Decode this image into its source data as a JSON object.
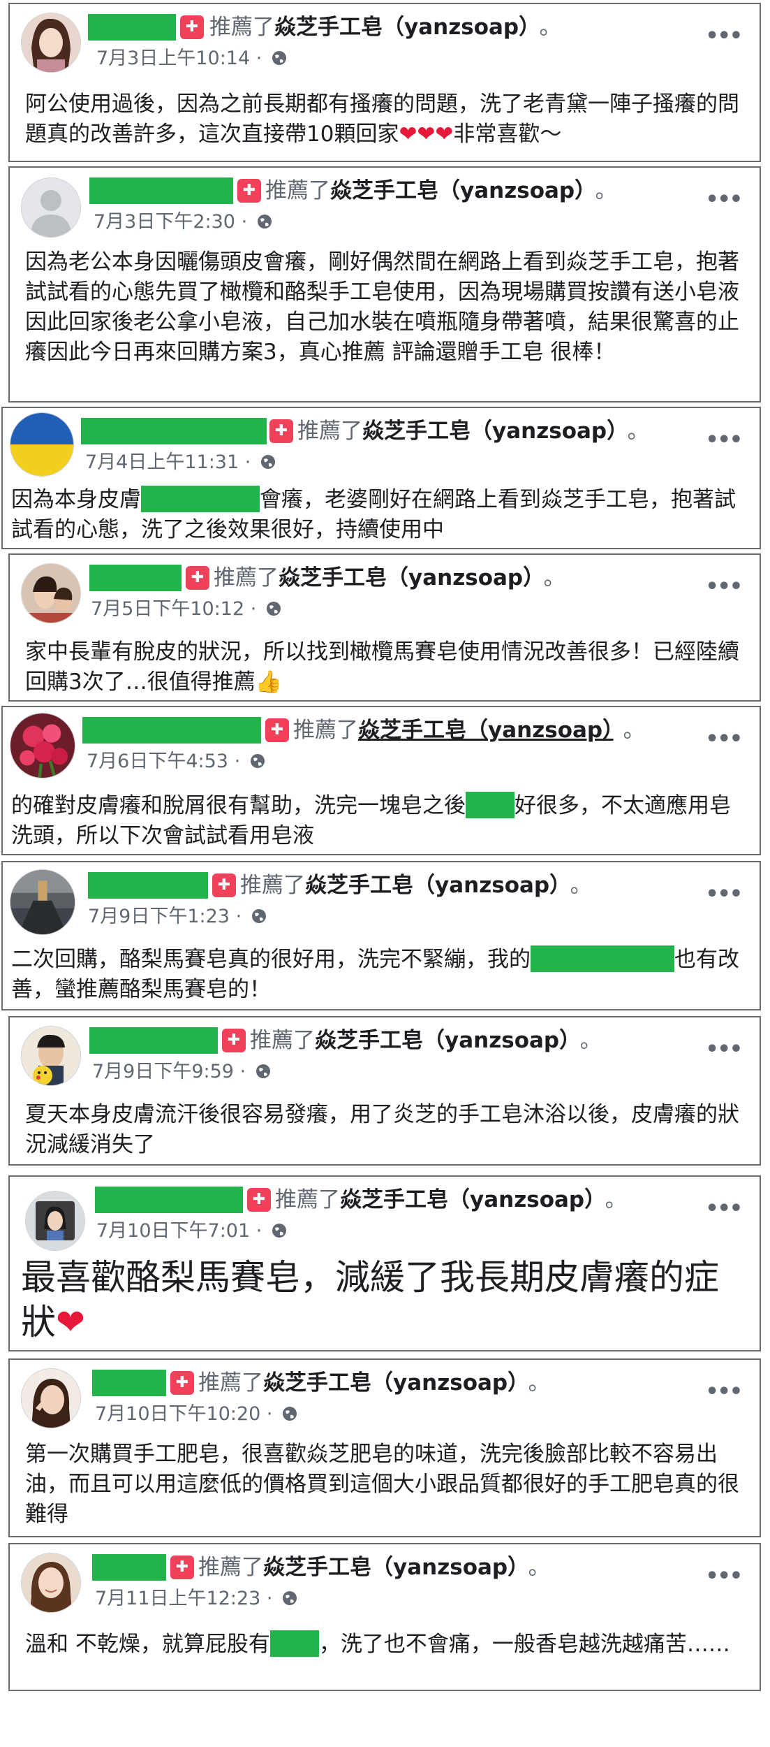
{
  "common": {
    "verb": "推薦了",
    "page_name": "焱芝手工皂（yanzsoap）",
    "dot": "。",
    "more": "•••",
    "badge_glyph": "✚"
  },
  "colors": {
    "redaction": "#22b34a",
    "badge": "#f0405a",
    "heart": "#e6193a",
    "meta": "#606770"
  },
  "posts": [
    {
      "time": "7月3日上午10:14 · ",
      "text1": "阿公使用過後，因為之前長期都有搔癢的問題，洗了老青黛一陣子搔癢的問題真的改善許多，這次直接帶10顆回家",
      "hearts": "❤❤❤",
      "text2": "非常喜歡～"
    },
    {
      "time": "7月3日下午2:30 · ",
      "text1": "因為老公本身因曬傷頭皮會癢，剛好偶然間在網路上看到焱芝手工皂，抱著試試看的心態先買了橄欖和酪梨手工皂使用，因為現場購買按讚有送小皂液因此回家後老公拿小皂液，自己加水裝在噴瓶隨身帶著噴，結果很驚喜的止癢因此今日再來回購方案3，真心推薦 評論還贈手工皂 很棒！"
    },
    {
      "time": "7月4日上午11:31 · ",
      "text1": "因為本身皮膚",
      "text2": "會癢，老婆剛好在網路上看到焱芝手工皂，抱著試試看的心態，洗了之後效果很好，持續使用中"
    },
    {
      "time": "7月5日下午10:12 · ",
      "text1": "家中長輩有脫皮的狀況，所以找到橄欖馬賽皂使用情況改善很多！已經陸續回購3次了…很值得推薦",
      "emoji": "👍"
    },
    {
      "time": "7月6日下午4:53 · ",
      "text1": "的確對皮膚癢和脫屑很有幫助，洗完一塊皂之後",
      "text2": "好很多，不太適應用皂洗頭，所以下次會試試看用皂液"
    },
    {
      "time": "7月9日下午1:23 · ",
      "text1": "二次回購，酪梨馬賽皂真的很好用，洗完不緊繃，我的",
      "text2": "也有改善，蠻推薦酪梨馬賽皂的！"
    },
    {
      "time": "7月9日下午9:59 · ",
      "text1": "夏天本身皮膚流汗後很容易發癢，用了炎芝的手工皂沐浴以後，皮膚癢的狀況減緩消失了"
    },
    {
      "time": "7月10日下午7:01 · ",
      "text1": "最喜歡酪梨馬賽皂，減緩了我長期皮膚癢的症狀",
      "hearts": "❤"
    },
    {
      "time": "7月10日下午10:20 · ",
      "text1": "第一次購買手工肥皂，很喜歡焱芝肥皂的味道，洗完後臉部比較不容易出油，而且可以用這麼低的價格買到這個大小跟品質都很好的手工肥皂真的很難得"
    },
    {
      "time": "7月11日上午12:23 · ",
      "text1": "溫和 不乾燥，就算屁股有",
      "text2": "，洗了也不會痛，一般香皂越洗越痛苦……"
    }
  ]
}
